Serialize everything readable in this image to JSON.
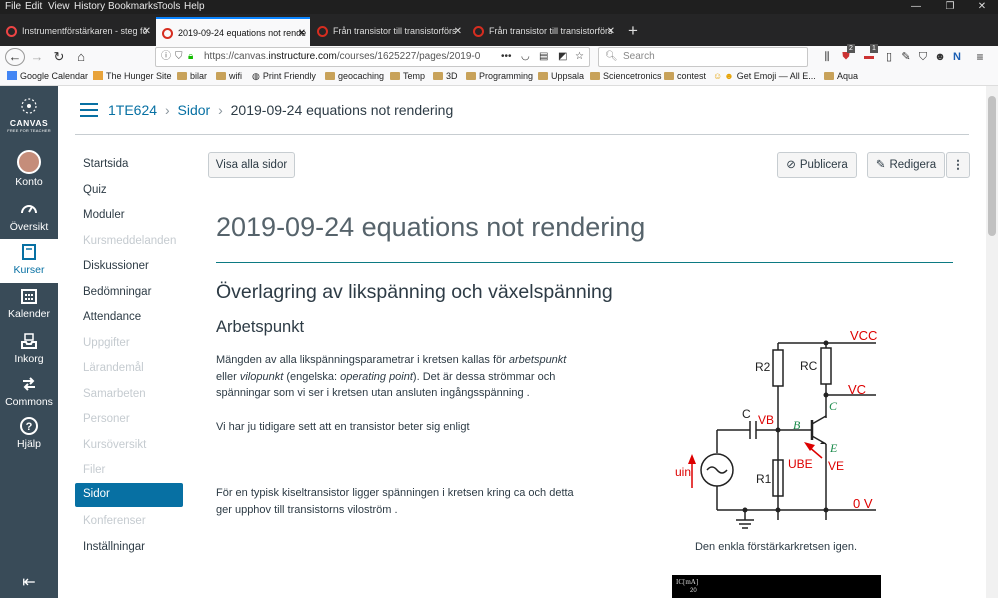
{
  "browser": {
    "menu": [
      "File",
      "Edit",
      "View",
      "History",
      "Bookmarks",
      "Tools",
      "Help"
    ],
    "tabs": [
      {
        "title": "Instrumentförstärkaren - steg fö"
      },
      {
        "title": "2019-09-24 equations not rende"
      },
      {
        "title": "Från transistor till transistorförs"
      },
      {
        "title": "Från transistor till transistorförs"
      }
    ],
    "url_prefix": "https://canvas.",
    "url_domain": "instructure.com",
    "url_rest": "/courses/1625227/pages/2019-0",
    "search_placeholder": "Search",
    "badge_a": "2",
    "badge_b": "1",
    "bookmarks": [
      "Google Calendar",
      "The Hunger Site",
      "bilar",
      "wifi",
      "Print Friendly",
      "geocaching",
      "Temp",
      "3D",
      "Programming",
      "Uppsala",
      "Sciencetronics",
      "contest",
      "Get Emoji — All E...",
      "Aqua"
    ]
  },
  "globalnav": {
    "logo": "CANVAS",
    "logo_sub": "FREE FOR TEACHER",
    "account": "Konto",
    "dashboard": "Översikt",
    "courses": "Kurser",
    "calendar": "Kalender",
    "inbox": "Inkorg",
    "commons": "Commons",
    "help": "Hjälp"
  },
  "breadcrumb": {
    "course": "1TE624",
    "section": "Sidor",
    "page": "2019-09-24 equations not rendering"
  },
  "coursenav": [
    "Startsida",
    "Quiz",
    "Moduler",
    "Kursmeddelanden",
    "Diskussioner",
    "Bedömningar",
    "Attendance",
    "Uppgifter",
    "Lärandemål",
    "Samarbeten",
    "Personer",
    "Kursöversikt",
    "Filer",
    "Sidor",
    "Konferenser",
    "Inställningar"
  ],
  "toolbar": {
    "view_all": "Visa alla sidor",
    "publish": "Publicera",
    "edit": "Redigera"
  },
  "content": {
    "title": "2019-09-24 equations not rendering",
    "h2": "Överlagring av likspänning och växelspänning",
    "h3": "Arbetspunkt",
    "p1_a": "Mängden av alla likspänningsparametrar i kretsen kallas för ",
    "p1_b": "arbetspunkt",
    "p1_c": "eller ",
    "p1_d": "vilopunkt",
    "p1_e": " (engelska: ",
    "p1_f": "operating point",
    "p1_g": "). Det är dessa strömmar och",
    "p1_h": "spänningar som vi ser i kretsen utan ansluten ingångsspänning .",
    "p2": "Vi har ju tidigare sett att en transistor beter sig enligt",
    "p3_a": "För en typisk kiseltransistor ligger spänningen  i kretsen kring ca  och detta",
    "p3_b": "ger upphov till transistorns viloström .",
    "caption": "Den enkla förstärkarkretsen igen.",
    "graph_label": "IC[mA]",
    "graph_tick": "20"
  },
  "circuit": {
    "vcc": "VCC",
    "vc": "VC",
    "c_node": "C",
    "r2": "R2",
    "rc": "RC",
    "cap": "C",
    "vb": "VB",
    "b_node": "B",
    "e_node": "E",
    "ube": "UBE",
    "ve": "VE",
    "r1": "R1",
    "uin": "uin",
    "zero": "0 V"
  }
}
